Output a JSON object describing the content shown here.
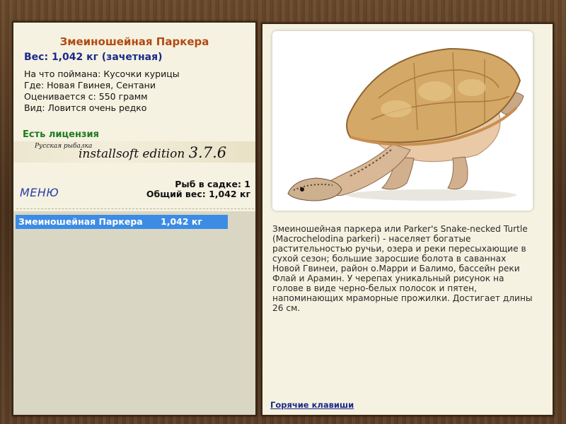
{
  "fish": {
    "title": "Змеиношейная Паркера",
    "weight": "Вес: 1,042 кг (зачетная)",
    "caught_on": "На что поймана: Кусочки курицы",
    "location": "Где: Новая Гвинея, Сентани",
    "valued_from": "Оценивается с: 550 грамм",
    "rarity": "Вид: Ловится очень редко"
  },
  "license": "Есть лицензия",
  "edition": {
    "brand": "Русская рыбалка",
    "name": "installsoft edition",
    "version": "3.7.6"
  },
  "menu_label": "МЕНЮ",
  "cage": {
    "count": "Рыб в садке: 1",
    "total_weight": "Общий вес: 1,042 кг"
  },
  "catch_list": [
    {
      "name": "Змеиношейная Паркера",
      "weight": "1,042 кг"
    }
  ],
  "description": "Змеиношейная паркера или Parker's Snake-necked Turtle (Macrochelodina parkeri) - населяет богатые растительностью ручьи, озера и реки пересыхающие в сухой сезон; большие заросшие болота в саваннах Новой Гвинеи, район о.Марри и Балимо, бассейн реки Флай и Арамин. У черепах уникальный рисунок на голове в виде черно-белых полосок и пятен, напоминающих мраморные прожилки. Достигает длины 26 см.",
  "hotkeys_label": "Горячие клавиши",
  "colors": {
    "title": "#b34a12",
    "weight": "#1c2a8a",
    "license": "#1e7a1e",
    "selection": "#3c8ce6",
    "panel": "#f5f2e1"
  }
}
